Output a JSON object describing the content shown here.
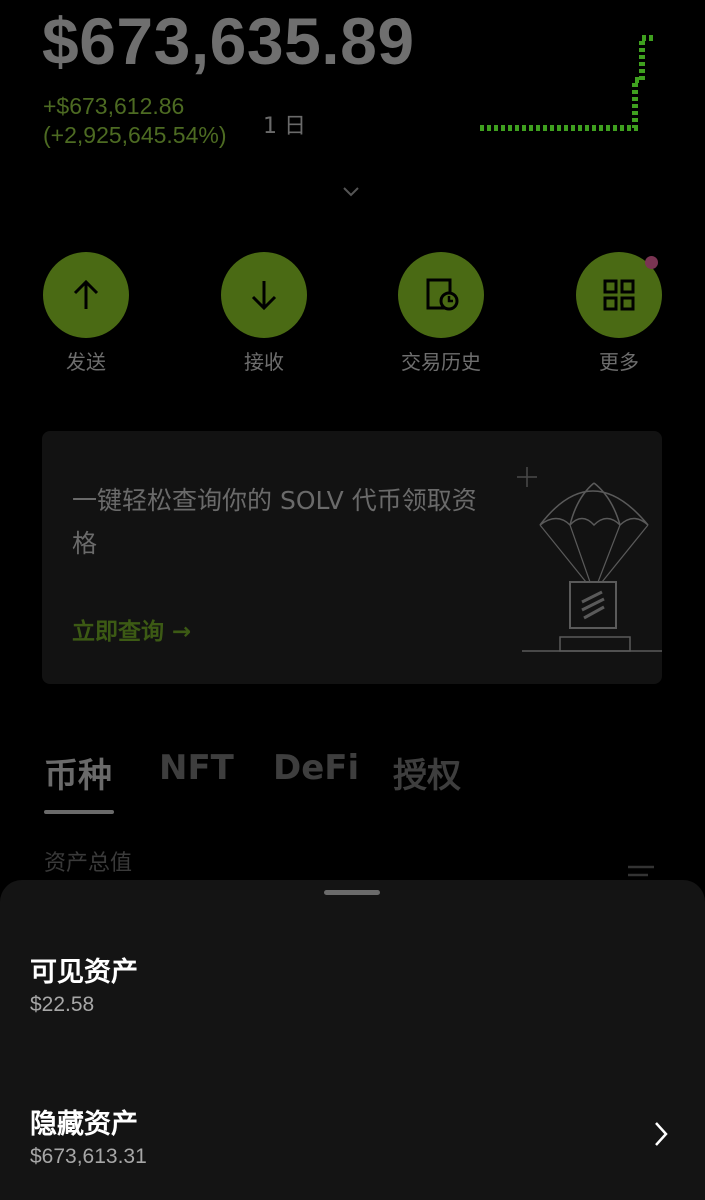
{
  "portfolio": {
    "balance": "$673,635.89",
    "change_amount": "+$673,612.86",
    "change_percent": "(+2,925,645.54%)",
    "period": "1 日",
    "chart_color": "#4fb12a"
  },
  "actions": [
    {
      "label": "发送",
      "icon": "arrow-up-icon"
    },
    {
      "label": "接收",
      "icon": "arrow-down-icon"
    },
    {
      "label": "交易历史",
      "icon": "history-icon"
    },
    {
      "label": "更多",
      "icon": "grid-icon"
    }
  ],
  "promo": {
    "text": "一键轻松查询你的 SOLV 代币领取资格",
    "link": "立即查询 →"
  },
  "tabs": [
    "币种",
    "NFT",
    "DeFi",
    "授权"
  ],
  "assets": {
    "total_label": "资产总值"
  },
  "sheet": {
    "visible_title": "可见资产",
    "visible_value": "$22.58",
    "hidden_title": "隐藏资产",
    "hidden_value": "$673,613.31"
  },
  "colors": {
    "accent_green": "#4a6a14",
    "background": "#000000",
    "sheet": "#141414"
  }
}
